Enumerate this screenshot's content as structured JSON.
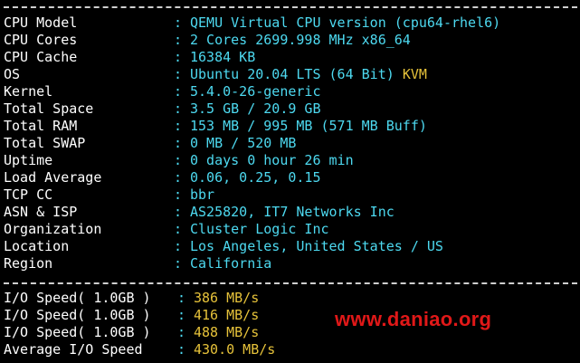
{
  "system": {
    "rows": [
      {
        "label": "CPU Model",
        "value": "QEMU Virtual CPU version (cpu64-rhel6)"
      },
      {
        "label": "CPU Cores",
        "value": "2 Cores 2699.998 MHz x86_64"
      },
      {
        "label": "CPU Cache",
        "value": "16384 KB"
      },
      {
        "label": "OS",
        "value": "Ubuntu 20.04 LTS (64 Bit)",
        "extra": "KVM"
      },
      {
        "label": "Kernel",
        "value": "5.4.0-26-generic"
      },
      {
        "label": "Total Space",
        "value": "3.5 GB / 20.9 GB"
      },
      {
        "label": "Total RAM",
        "value": "153 MB / 995 MB (571 MB Buff)"
      },
      {
        "label": "Total SWAP",
        "value": "0 MB / 520 MB"
      },
      {
        "label": "Uptime",
        "value": "0 days 0 hour 26 min"
      },
      {
        "label": "Load Average",
        "value": "0.06, 0.25, 0.15"
      },
      {
        "label": "TCP CC",
        "value": "bbr"
      },
      {
        "label": "ASN & ISP",
        "value": "AS25820, IT7 Networks Inc"
      },
      {
        "label": "Organization",
        "value": "Cluster Logic Inc"
      },
      {
        "label": "Location",
        "value": "Los Angeles, United States / US"
      },
      {
        "label": "Region",
        "value": "California"
      }
    ]
  },
  "io": {
    "rows": [
      {
        "label": "I/O Speed( 1.0GB )",
        "value": "386 MB/s"
      },
      {
        "label": "I/O Speed( 1.0GB )",
        "value": "416 MB/s"
      },
      {
        "label": "I/O Speed( 1.0GB )",
        "value": "488 MB/s"
      },
      {
        "label": "Average I/O Speed",
        "value": "430.0 MB/s"
      }
    ]
  },
  "separator": ":",
  "watermark": "www.daniao.org",
  "colors": {
    "background": "#000000",
    "label": "#ffffff",
    "value": "#4dd9f0",
    "highlight": "#e6c23a",
    "watermark": "#e01818"
  }
}
